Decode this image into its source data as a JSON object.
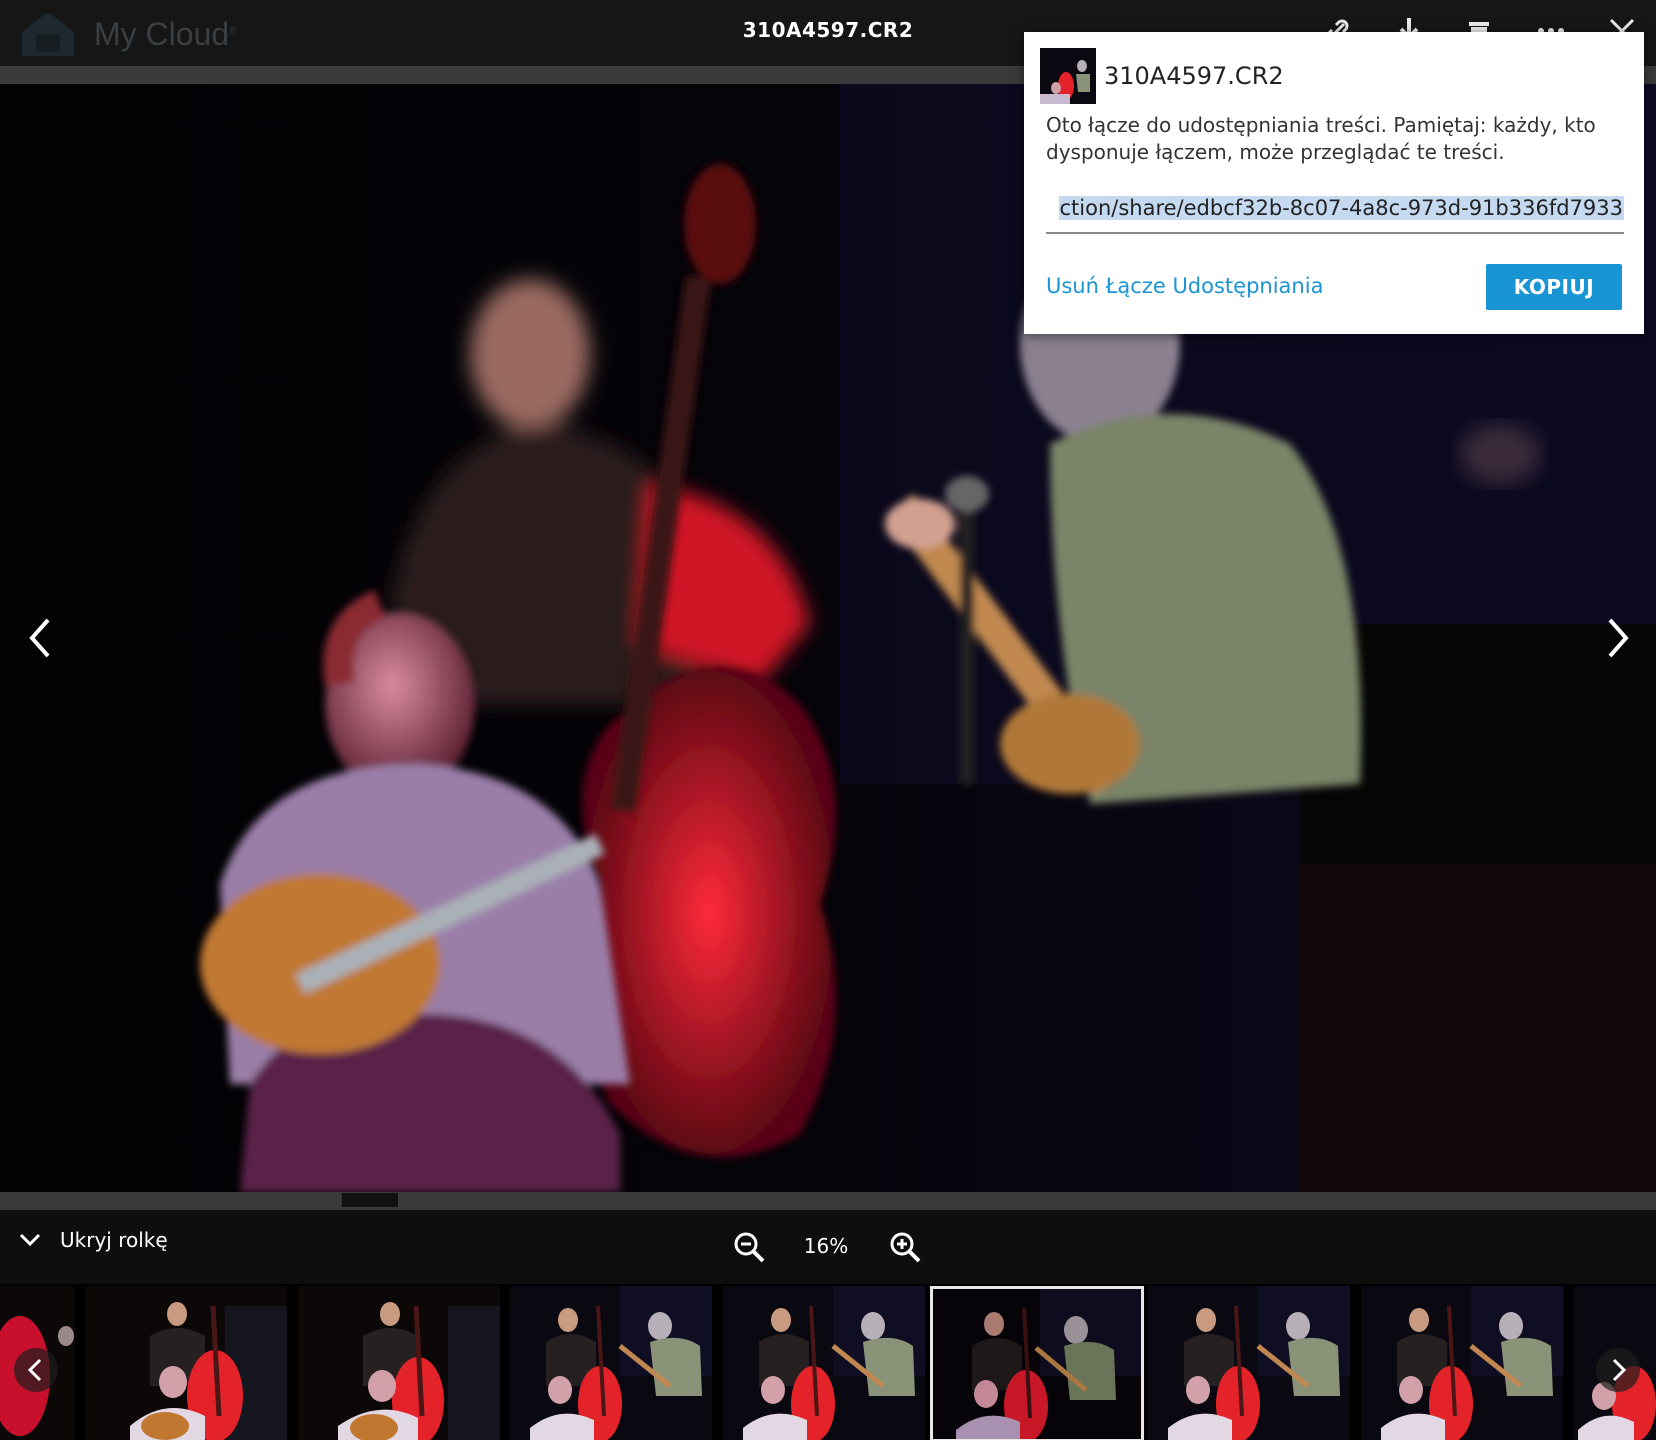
{
  "app": {
    "name": "My Cloud",
    "trademark": "®"
  },
  "viewer": {
    "file_title": "310A4597.CR2",
    "icons": [
      "link-icon",
      "download-icon",
      "trash-icon",
      "more-icon",
      "close-icon"
    ]
  },
  "share_popup": {
    "title": "310A4597.CR2",
    "message": "Oto łącze do udostępniania treści. Pamiętaj: każdy, kto dysponuje łączem, może przeglądać te treści.",
    "link_value": "ction/share/edbcf32b-8c07-4a8c-973d-91b336fd7933",
    "remove_label": "Usuń Łącze Udostępniania",
    "copy_label": "KOPIUJ"
  },
  "controls": {
    "hide_roll_label": "Ukryj rolkę",
    "zoom_level": "16%"
  },
  "filmstrip": {
    "thumbnail_count": 9,
    "selected_index": 5
  },
  "colors": {
    "accent": "#1a95d4",
    "topbar": "#161616",
    "selection": "#c5d9f0"
  }
}
